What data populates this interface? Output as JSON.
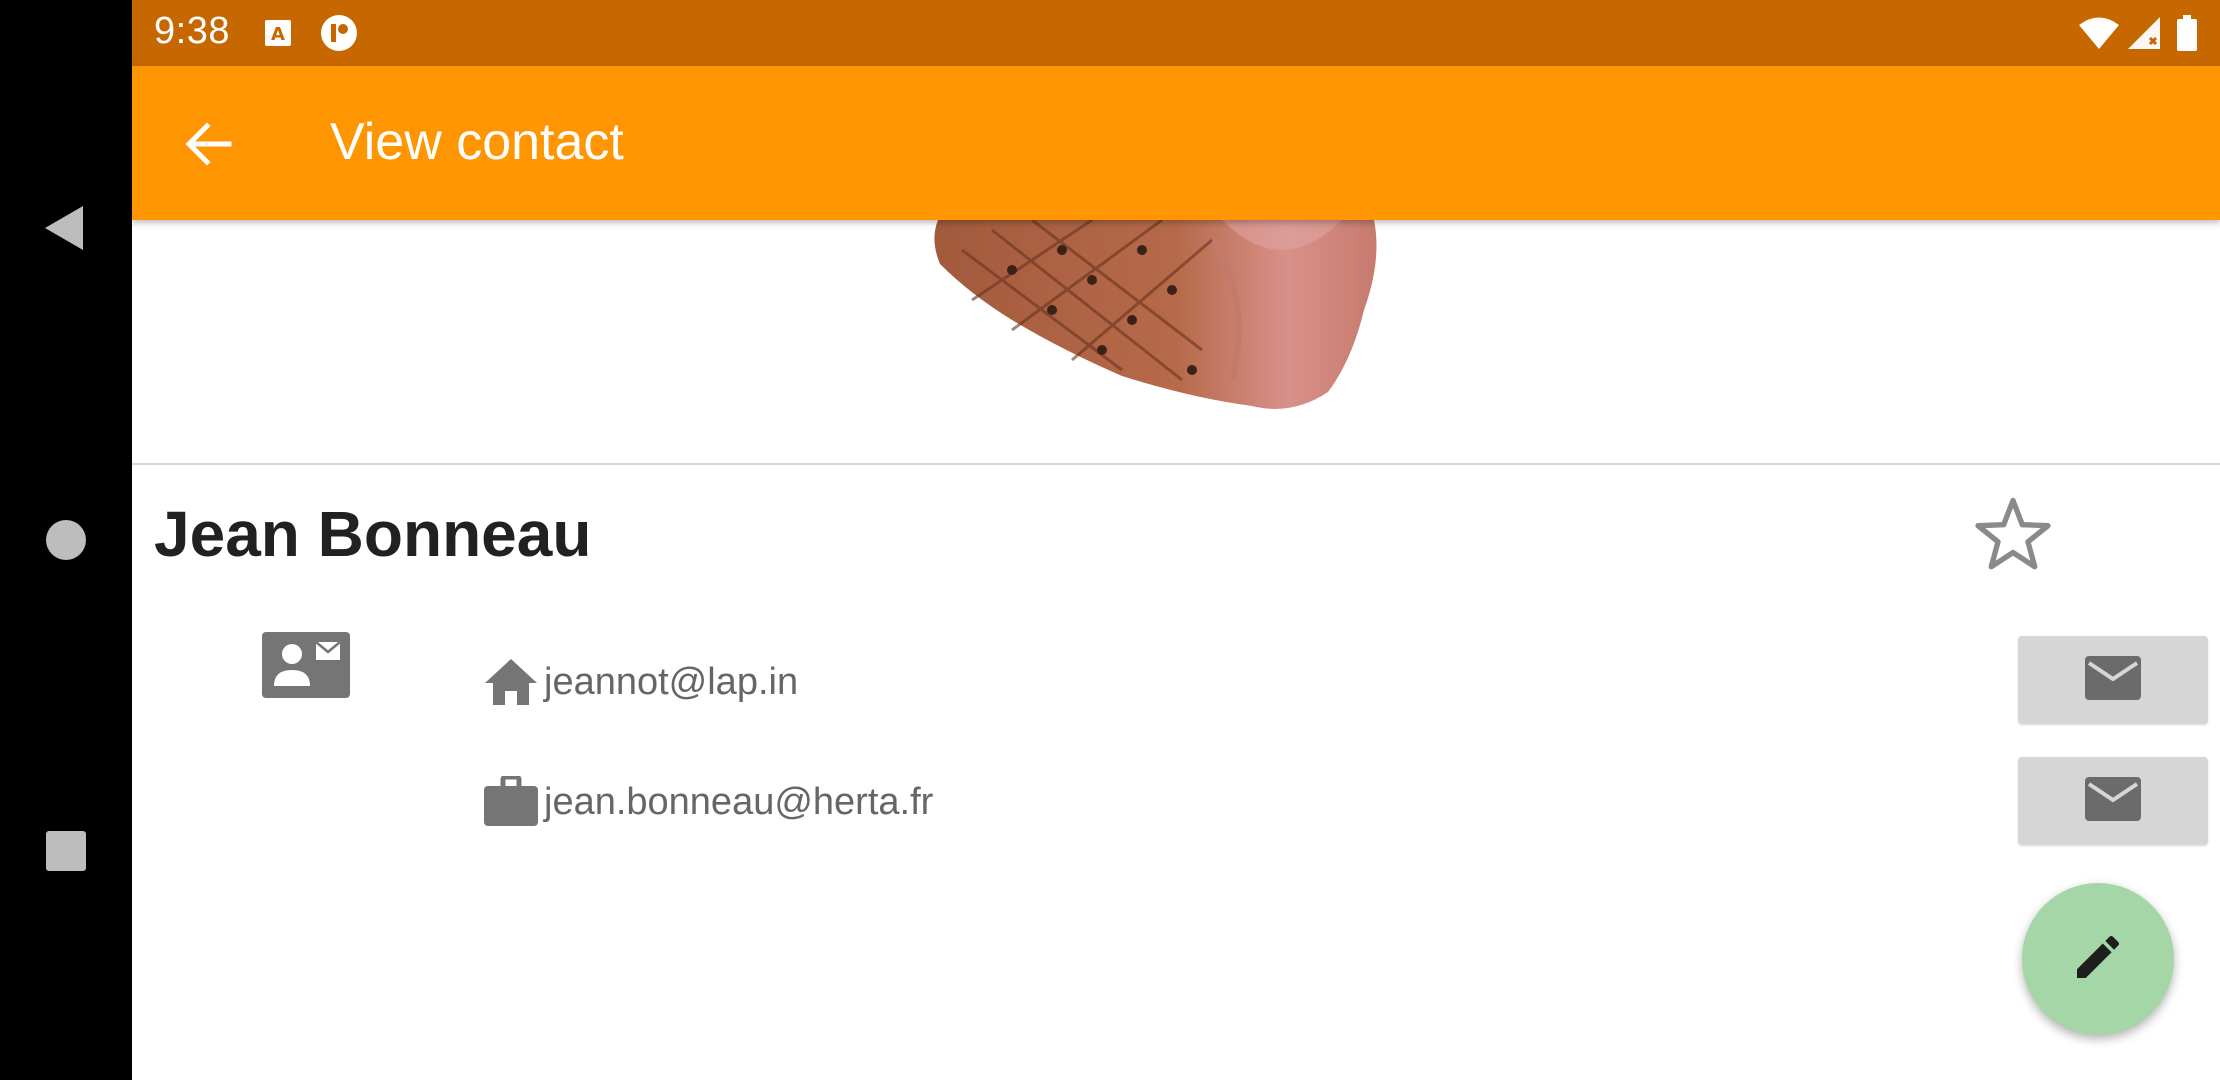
{
  "status_bar": {
    "time": "9:38"
  },
  "app_bar": {
    "title": "View contact",
    "back_icon": "arrow-back-icon"
  },
  "contact": {
    "name": "Jean Bonneau",
    "favorite_icon": "star-outline-icon",
    "section_icon": "contact-mail-icon",
    "emails": [
      {
        "type_icon": "home-icon",
        "address": "jeannot@lap.in",
        "action_icon": "email-icon"
      },
      {
        "type_icon": "work-briefcase-icon",
        "address": "jean.bonneau@herta.fr",
        "action_icon": "email-icon"
      }
    ]
  },
  "fab": {
    "icon": "edit-pencil-icon"
  },
  "colors": {
    "status_bar": "#c66700",
    "app_bar": "#ff9500",
    "fab": "#a5d6a7",
    "mail_button": "#d6d6d6",
    "icon_gray": "#757575"
  }
}
